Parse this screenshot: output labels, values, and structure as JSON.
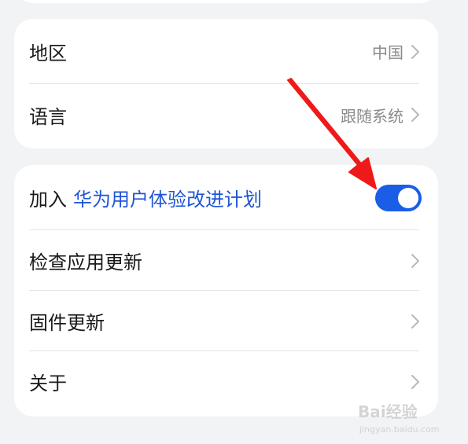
{
  "settings": {
    "group1": {
      "region": {
        "label": "地区",
        "value": "中国"
      },
      "language": {
        "label": "语言",
        "value": "跟随系统"
      }
    },
    "group2": {
      "experience_program": {
        "prefix": "加入",
        "link": "华为用户体验改进计划",
        "enabled": true
      },
      "check_app_updates": {
        "label": "检查应用更新"
      },
      "firmware_update": {
        "label": "固件更新"
      },
      "about": {
        "label": "关于"
      }
    }
  },
  "colors": {
    "page_background": "#f1f3f5",
    "card_background": "#ffffff",
    "accent_blue": "#1a5ee8",
    "link_blue": "#1f55d6",
    "annotation_red": "#f01919"
  },
  "icons": {
    "chevron": "chevron-right-icon",
    "annotation": "red-arrow-icon"
  },
  "watermark": {
    "logo_text": "Bai经验",
    "url": "jingyan.baidu.com"
  }
}
